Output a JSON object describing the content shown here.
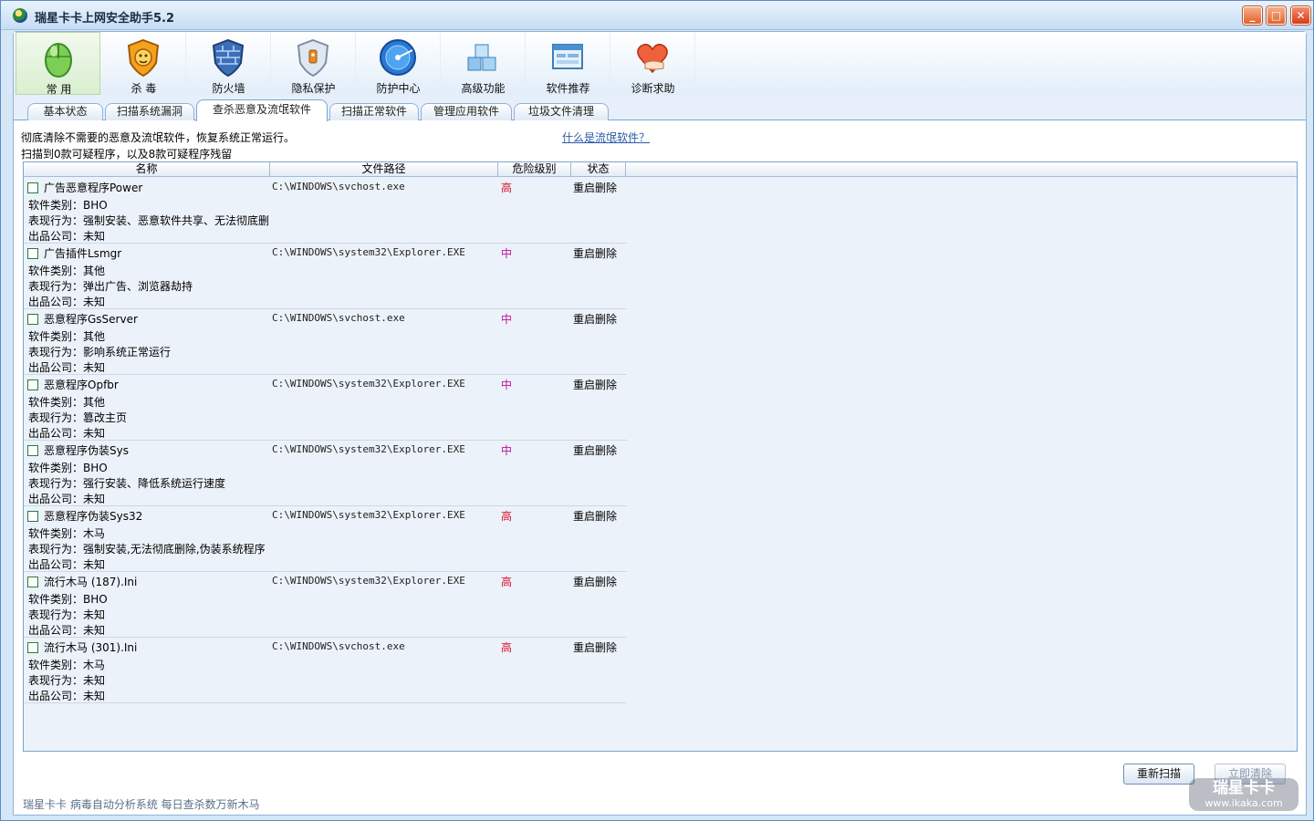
{
  "window": {
    "title": "瑞星卡卡上网安全助手5.2"
  },
  "toolbar": [
    {
      "label": "常 用",
      "icon": "mouse-icon"
    },
    {
      "label": "杀 毒",
      "icon": "lion-shield-icon"
    },
    {
      "label": "防火墙",
      "icon": "firewall-shield-icon"
    },
    {
      "label": "隐私保护",
      "icon": "privacy-shield-icon"
    },
    {
      "label": "防护中心",
      "icon": "radar-icon"
    },
    {
      "label": "高级功能",
      "icon": "cubes-icon"
    },
    {
      "label": "软件推荐",
      "icon": "software-window-icon"
    },
    {
      "label": "诊断求助",
      "icon": "heart-hand-icon"
    }
  ],
  "tabs": [
    {
      "label": "基本状态"
    },
    {
      "label": "扫描系统漏洞"
    },
    {
      "label": "查杀恶意及流氓软件"
    },
    {
      "label": "扫描正常软件"
    },
    {
      "label": "管理应用软件"
    },
    {
      "label": "垃圾文件清理"
    }
  ],
  "main": {
    "description": "彻底清除不需要的恶意及流氓软件，恢复系统正常运行。",
    "scan_summary": "扫描到0款可疑程序，以及8款可疑程序残留",
    "help_link": "什么是流氓软件？"
  },
  "list": {
    "columns": [
      "名称",
      "文件路径",
      "危险级别",
      "状态"
    ],
    "rows": [
      {
        "name": "广告恶意程序Power",
        "path": "C:\\WINDOWS\\svchost.exe",
        "risk": "高",
        "status": "重启删除",
        "type": "软件类别：BHO",
        "behavior": "表现行为：强制安装、恶意软件共享、无法彻底删",
        "company": "出品公司：未知"
      },
      {
        "name": "广告插件Lsmgr",
        "path": "C:\\WINDOWS\\system32\\Explorer.EXE",
        "risk": "中",
        "status": "重启删除",
        "type": "软件类别：其他",
        "behavior": "表现行为：弹出广告、浏览器劫持",
        "company": "出品公司：未知"
      },
      {
        "name": "恶意程序GsServer",
        "path": "C:\\WINDOWS\\svchost.exe",
        "risk": "中",
        "status": "重启删除",
        "type": "软件类别：其他",
        "behavior": "表现行为：影响系统正常运行",
        "company": "出品公司：未知"
      },
      {
        "name": "恶意程序Opfbr",
        "path": "C:\\WINDOWS\\system32\\Explorer.EXE",
        "risk": "中",
        "status": "重启删除",
        "type": "软件类别：其他",
        "behavior": "表现行为：篡改主页",
        "company": "出品公司：未知"
      },
      {
        "name": "恶意程序伪装Sys",
        "path": "C:\\WINDOWS\\system32\\Explorer.EXE",
        "risk": "中",
        "status": "重启删除",
        "type": "软件类别：BHO",
        "behavior": "表现行为：强行安装、降低系统运行速度",
        "company": "出品公司：未知"
      },
      {
        "name": "恶意程序伪装Sys32",
        "path": "C:\\WINDOWS\\system32\\Explorer.EXE",
        "risk": "高",
        "status": "重启删除",
        "type": "软件类别：木马",
        "behavior": "表现行为：强制安装,无法彻底删除,伪装系统程序",
        "company": "出品公司：未知"
      },
      {
        "name": "流行木马 (187).Ini",
        "path": "C:\\WINDOWS\\system32\\Explorer.EXE",
        "risk": "高",
        "status": "重启删除",
        "type": "软件类别：BHO",
        "behavior": "表现行为：未知",
        "company": "出品公司：未知"
      },
      {
        "name": "流行木马 (301).Ini",
        "path": "C:\\WINDOWS\\svchost.exe",
        "risk": "高",
        "status": "重启删除",
        "type": "软件类别：木马",
        "behavior": "表现行为：未知",
        "company": "出品公司：未知"
      }
    ]
  },
  "risk_colors": {
    "高": "#d8102a",
    "中": "#c0109a"
  },
  "buttons": {
    "rescan": "重新扫描",
    "clean_now": "立即清除"
  },
  "footer": {
    "text": "瑞星卡卡 病毒自动分析系统 每日查杀数万新木马"
  },
  "watermark": {
    "brand": "瑞星卡卡",
    "url": "www.ikaka.com"
  }
}
